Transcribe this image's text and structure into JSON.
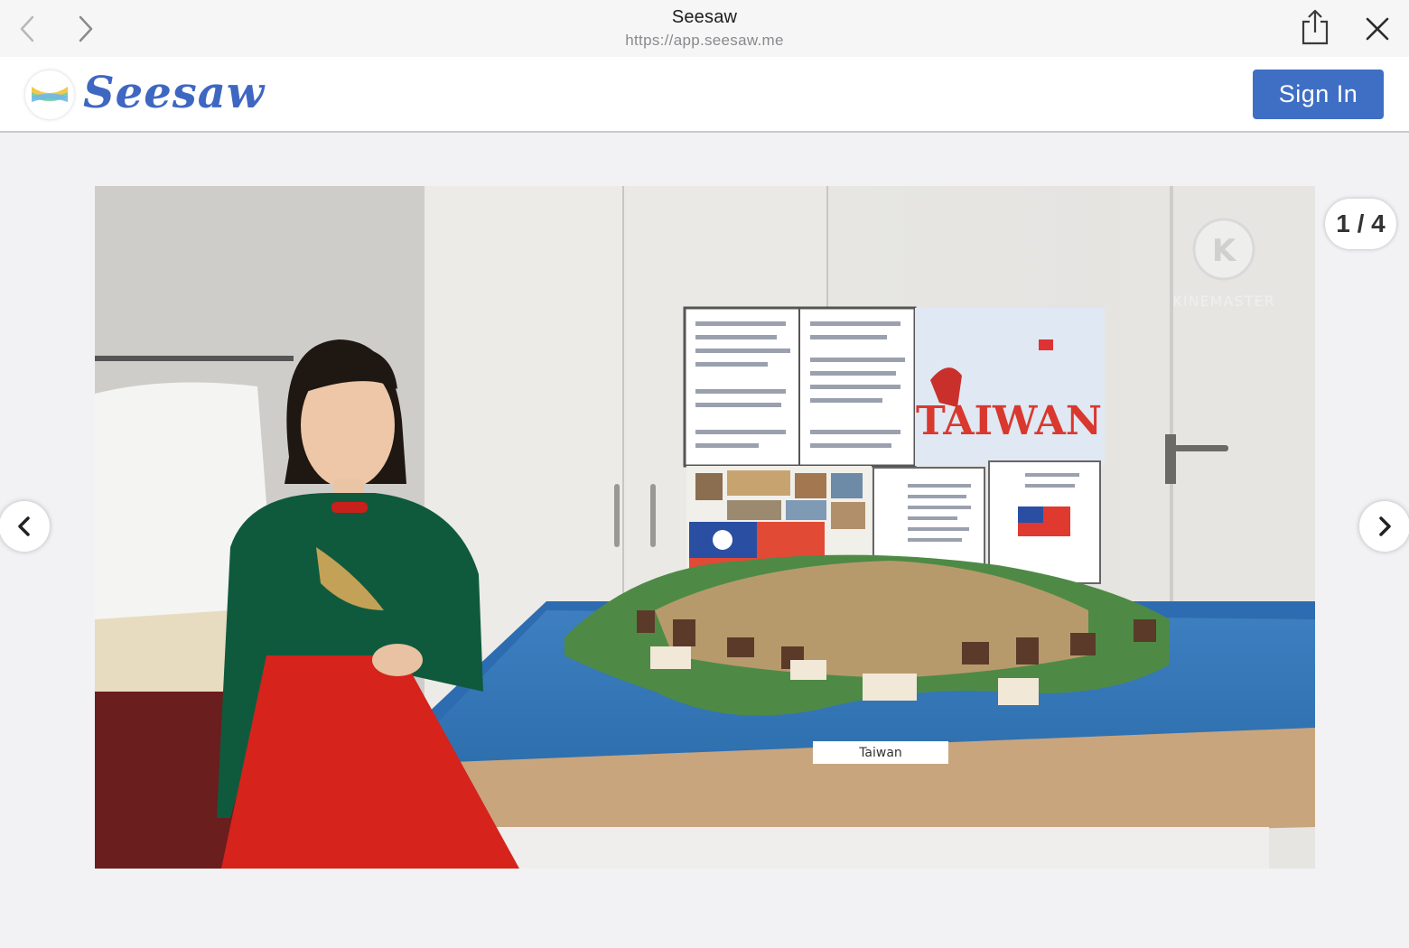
{
  "browser": {
    "title": "Seesaw",
    "url": "https://app.seesaw.me",
    "back_icon": "chevron-left-icon",
    "forward_icon": "chevron-right-icon",
    "share_icon": "share-icon",
    "close_icon": "close-icon"
  },
  "header": {
    "logo_text": "Seesaw",
    "sign_in_label": "Sign In",
    "brand_color": "#3f6fc4"
  },
  "viewer": {
    "counter": "1 / 4",
    "prev_icon": "chevron-left-icon",
    "next_icon": "chevron-right-icon",
    "watermark": "KINEMASTER",
    "poster_text": "TAIWAN",
    "map_label": "Taiwan"
  }
}
